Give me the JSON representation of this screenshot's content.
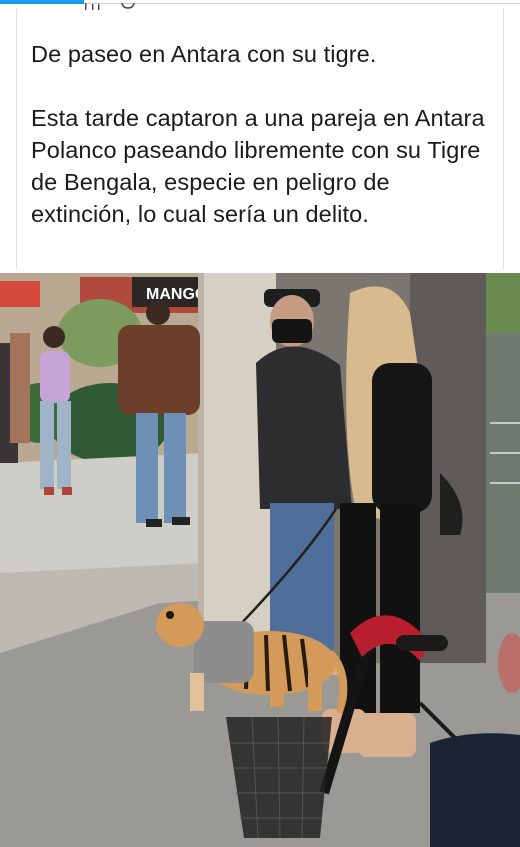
{
  "post": {
    "title": "De paseo en Antara con su tigre.",
    "body": "Esta tarde captaron a una pareja en Antara Polanco paseando libremente con su Tigre de Bengala, especie en peligro de extinción, lo cual sería un delito."
  },
  "photo": {
    "store_sign": "MANGO"
  },
  "colors": {
    "accent": "#1d9bf0",
    "text": "#1b1b1b"
  }
}
